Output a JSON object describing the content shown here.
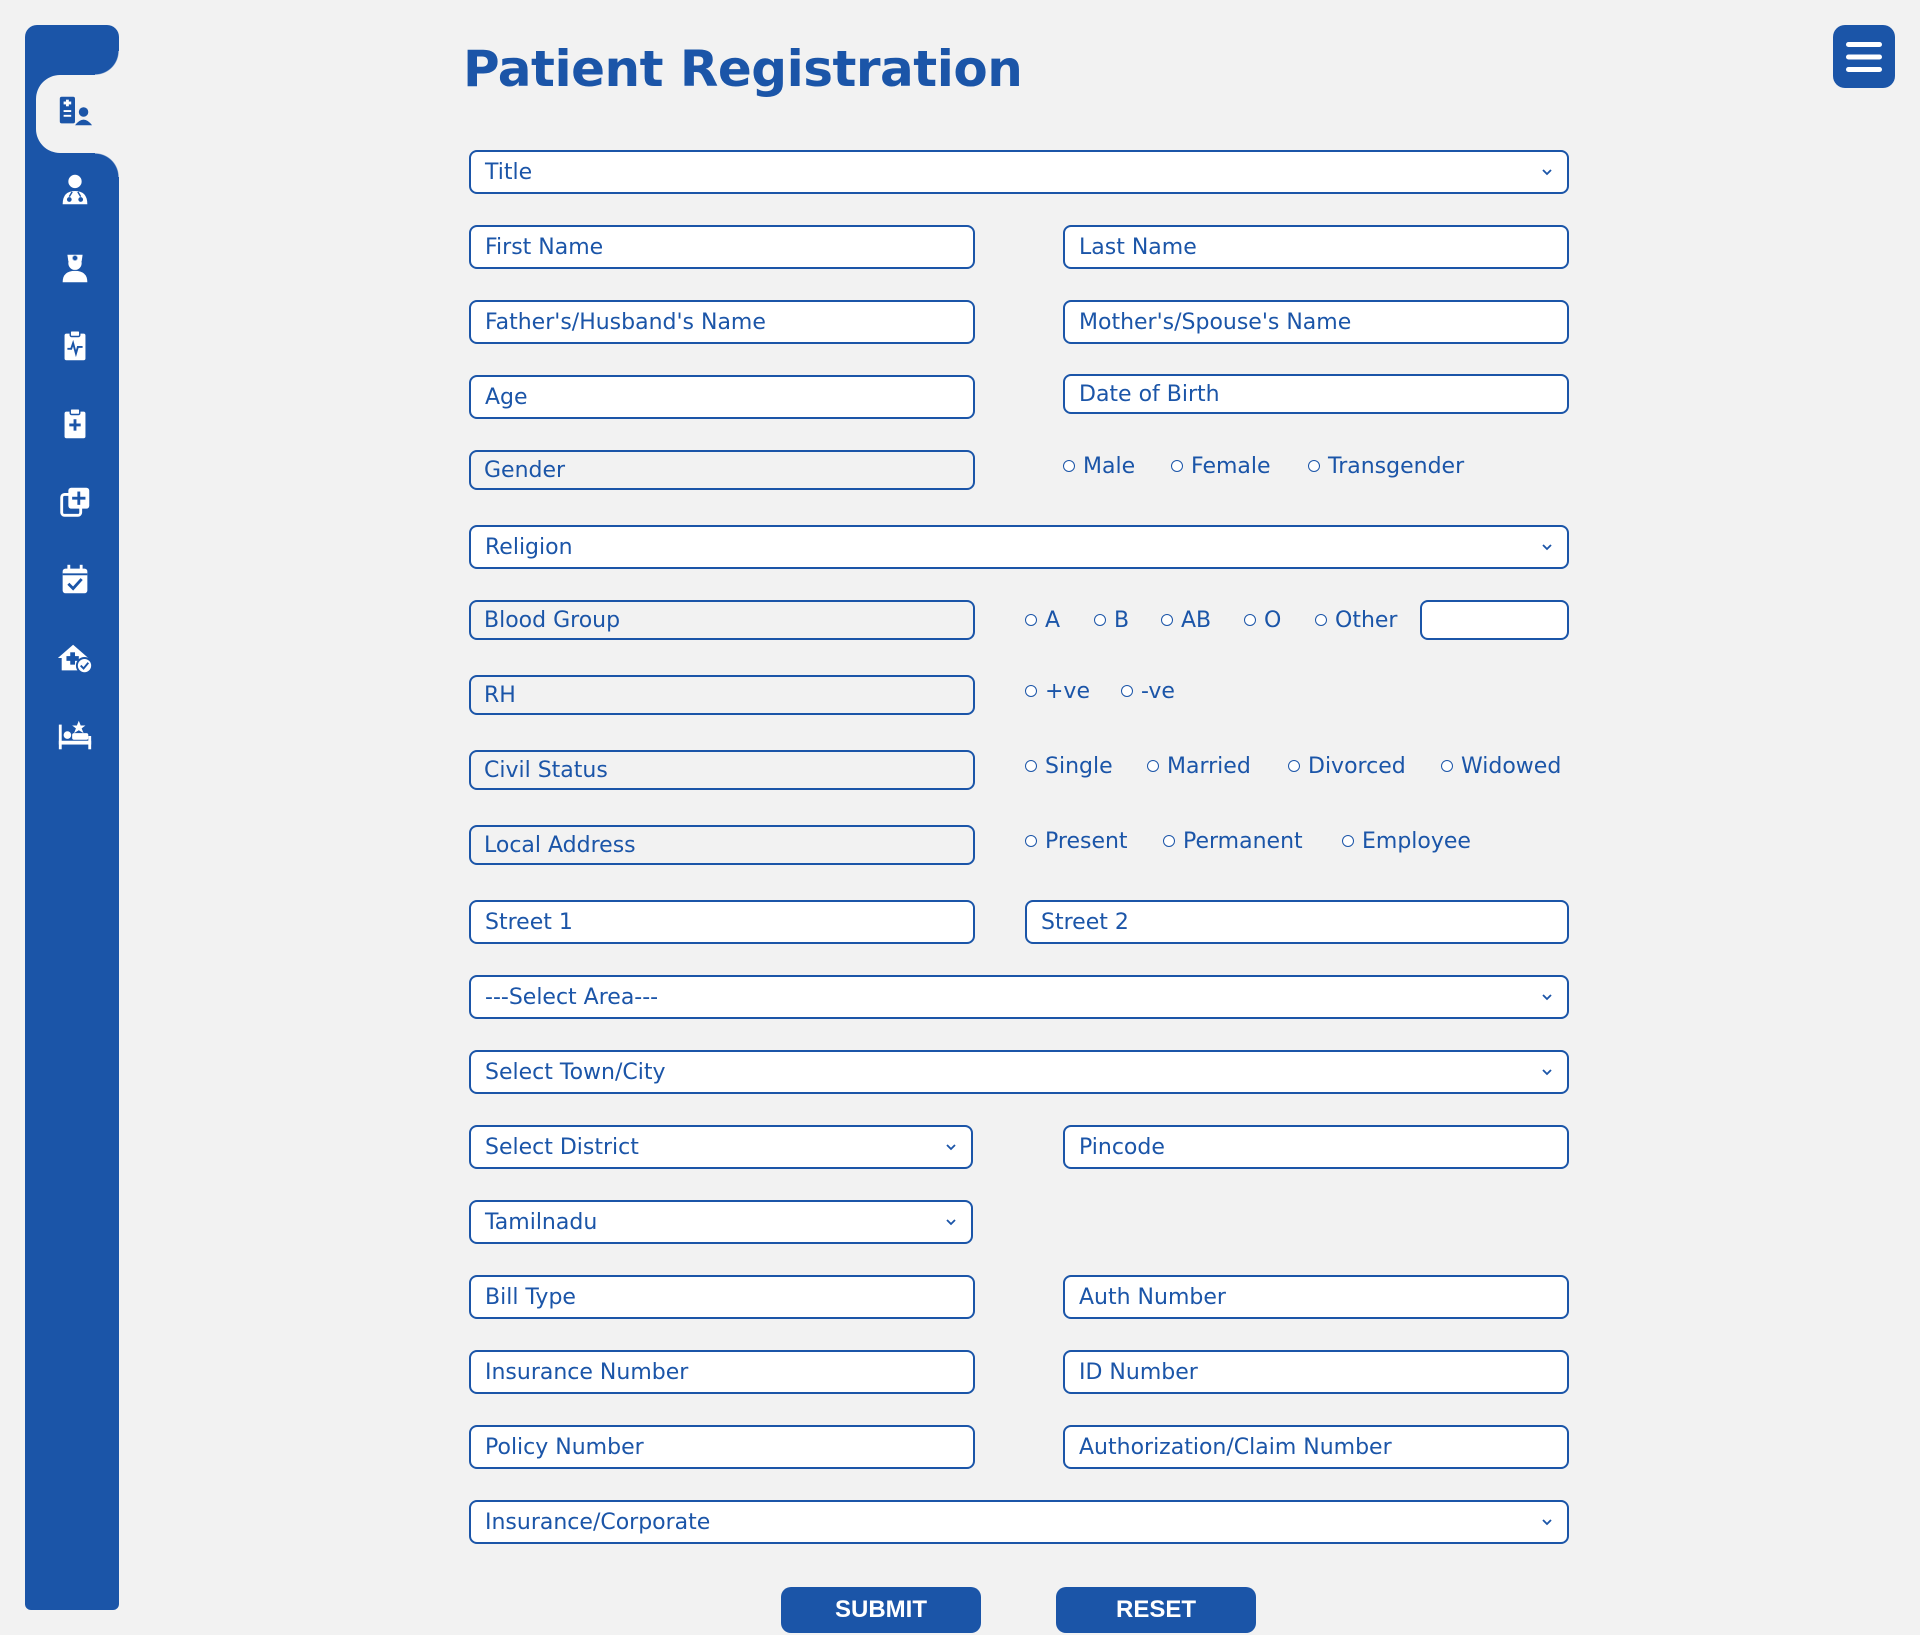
{
  "page_title": "Patient Registration",
  "sidebar": {
    "icons": [
      "patient-registration-icon",
      "doctor-icon",
      "nurse-icon",
      "clipboard-vitals-icon",
      "clipboard-plus-icon",
      "medical-copy-icon",
      "calendar-check-icon",
      "home-care-icon",
      "hospital-bed-icon"
    ]
  },
  "form": {
    "title_select": "Title",
    "first_name": "First Name",
    "last_name": "Last Name",
    "father_name": "Father's/Husband's Name",
    "mother_name": "Mother's/Spouse's Name",
    "age": "Age",
    "dob": "Date of Birth",
    "gender_label": "Gender",
    "gender_options": [
      "Male",
      "Female",
      "Transgender"
    ],
    "religion_select": "Religion",
    "blood_group_label": "Blood Group",
    "blood_group_options": [
      "A",
      "B",
      "AB",
      "O",
      "Other"
    ],
    "rh_label": "RH",
    "rh_options": [
      "+ve",
      "-ve"
    ],
    "civil_status_label": "Civil Status",
    "civil_status_options": [
      "Single",
      "Married",
      "Divorced",
      "Widowed"
    ],
    "local_address_label": "Local Address",
    "address_type_options": [
      "Present",
      "Permanent",
      "Employee"
    ],
    "street1": "Street 1",
    "street2": "Street 2",
    "area_select": "---Select Area---",
    "town_select": "Select Town/City",
    "district_select": "Select District",
    "pincode": "Pincode",
    "state_select": "Tamilnadu",
    "bill_type": "Bill Type",
    "auth_number": "Auth Number",
    "insurance_number": "Insurance Number",
    "id_number": "ID Number",
    "policy_number": "Policy Number",
    "claim_number": "Authorization/Claim Number",
    "insurance_select": "Insurance/Corporate"
  },
  "buttons": {
    "submit": "SUBMIT",
    "reset": "RESET"
  },
  "colors": {
    "accent": "#1b55a8",
    "background": "#f2f2f2"
  }
}
